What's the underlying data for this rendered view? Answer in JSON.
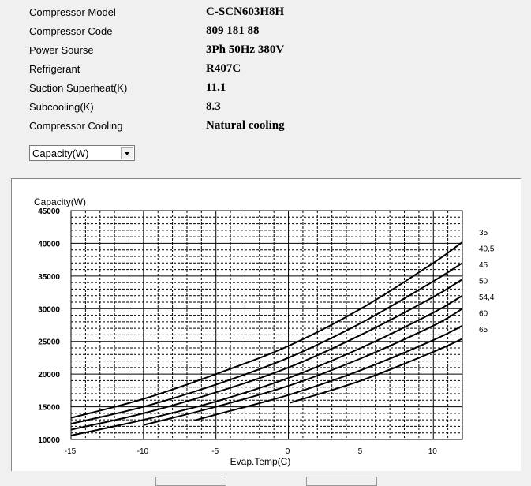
{
  "info": [
    {
      "label": "Compressor  Model",
      "value": "C-SCN603H8H"
    },
    {
      "label": "Compressor Code",
      "value": "809 181 88"
    },
    {
      "label": "Power Sourse",
      "value": "3Ph  50Hz  380V"
    },
    {
      "label": "Refrigerant",
      "value": "R407C"
    },
    {
      "label": "Suction Superheat(K)",
      "value": "11.1"
    },
    {
      "label": "Subcooling(K)",
      "value": "8.3"
    },
    {
      "label": "Compressor Cooling",
      "value": "Natural cooling"
    }
  ],
  "selector": {
    "value": "Capacity(W)"
  },
  "chart_data": {
    "type": "line",
    "ylabel": "Capacity(W)",
    "xlabel": "Evap.Temp(C)",
    "xlim": [
      -15,
      12
    ],
    "ylim": [
      10000,
      45000
    ],
    "xticks": [
      "-15",
      "-10",
      "-5",
      "0",
      "5",
      "10"
    ],
    "yticks": [
      "45000",
      "40000",
      "35000",
      "30000",
      "25000",
      "20000",
      "15000",
      "10000"
    ],
    "grid": {
      "major": true,
      "minor_dashed": true
    },
    "legend_placement": "right",
    "series": [
      {
        "name": "35",
        "points": [
          [
            -15,
            13300
          ],
          [
            -10,
            16200
          ],
          [
            -5,
            20000
          ],
          [
            0,
            24300
          ],
          [
            5,
            30000
          ],
          [
            10,
            37000
          ],
          [
            12,
            40200
          ]
        ]
      },
      {
        "name": "40,5",
        "points": [
          [
            -15,
            12400
          ],
          [
            -10,
            15000
          ],
          [
            -5,
            18400
          ],
          [
            0,
            22500
          ],
          [
            5,
            27800
          ],
          [
            10,
            34200
          ],
          [
            12,
            37000
          ]
        ]
      },
      {
        "name": "45",
        "points": [
          [
            -15,
            11500
          ],
          [
            -10,
            14000
          ],
          [
            -5,
            17200
          ],
          [
            0,
            21000
          ],
          [
            5,
            26000
          ],
          [
            10,
            31800
          ],
          [
            12,
            34500
          ]
        ]
      },
      {
        "name": "50",
        "points": [
          [
            -15,
            10600
          ],
          [
            -10,
            13000
          ],
          [
            -5,
            15800
          ],
          [
            0,
            19400
          ],
          [
            5,
            24000
          ],
          [
            10,
            29400
          ],
          [
            12,
            32000
          ]
        ]
      },
      {
        "name": "54,4",
        "points": [
          [
            -10,
            12200
          ],
          [
            -5,
            15000
          ],
          [
            0,
            18200
          ],
          [
            5,
            22400
          ],
          [
            10,
            27400
          ],
          [
            12,
            30000
          ]
        ]
      },
      {
        "name": "60",
        "points": [
          [
            -6.5,
            12900
          ],
          [
            -5,
            13800
          ],
          [
            0,
            16800
          ],
          [
            5,
            20600
          ],
          [
            10,
            25200
          ],
          [
            12,
            27400
          ]
        ]
      },
      {
        "name": "65",
        "points": [
          [
            0.1,
            15600
          ],
          [
            5,
            19000
          ],
          [
            10,
            23400
          ],
          [
            12,
            25400
          ]
        ]
      }
    ]
  }
}
